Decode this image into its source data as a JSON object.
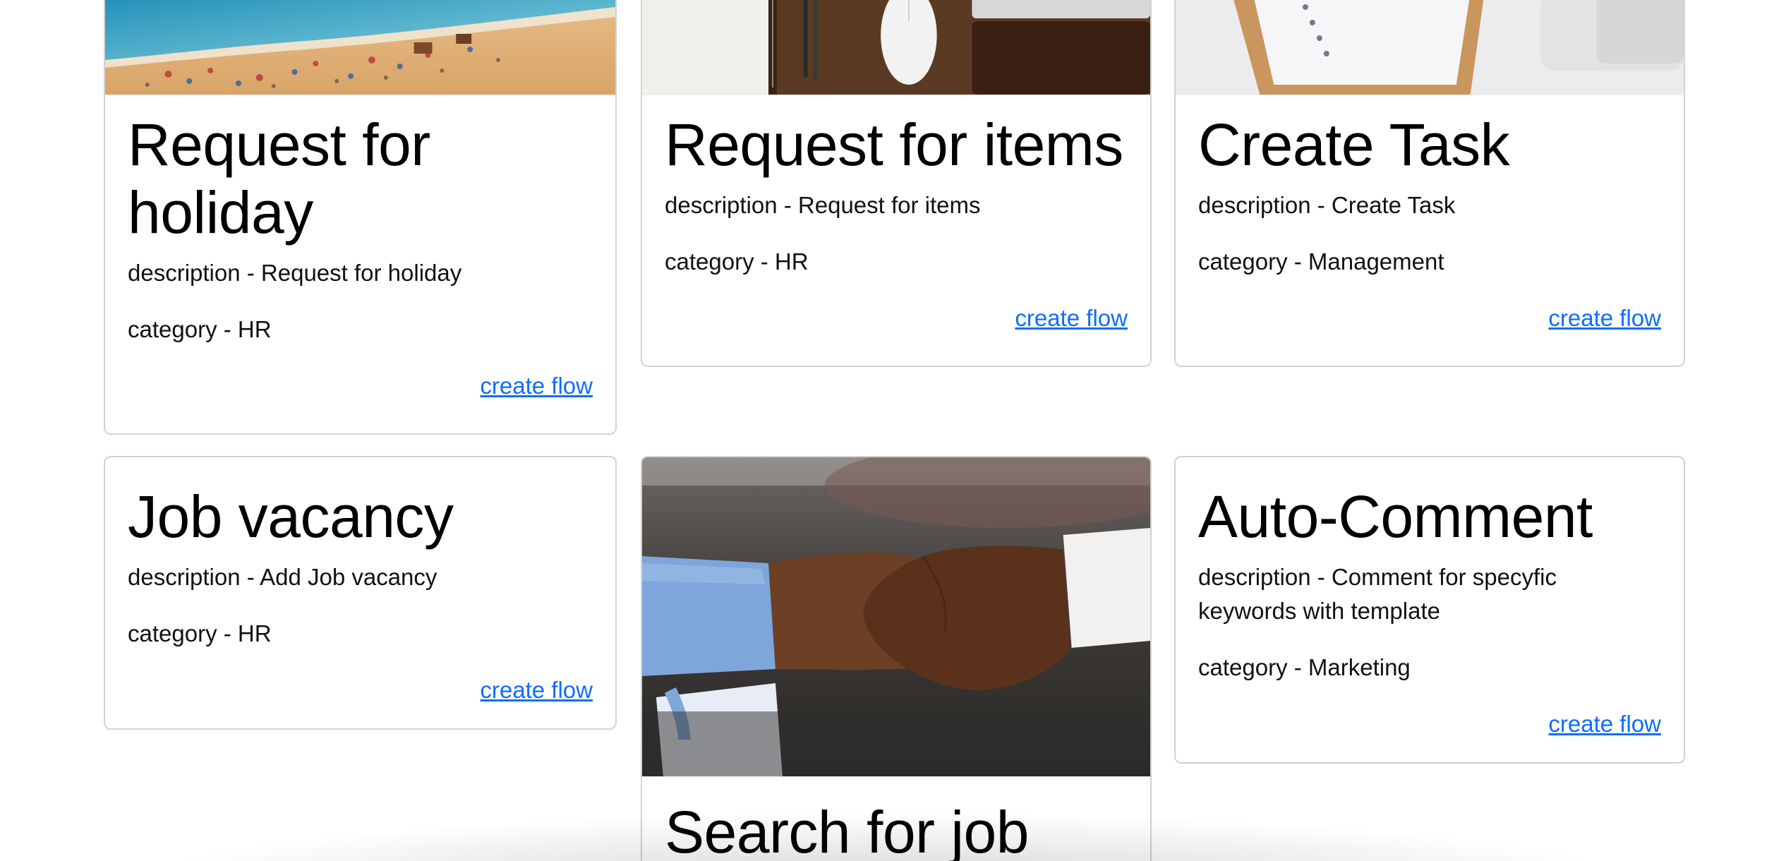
{
  "cards": [
    {
      "title": "Request for holiday",
      "description": "description - Request for holiday",
      "category": "category - HR",
      "link": "create flow",
      "image": "beach-photo"
    },
    {
      "title": "Request for items",
      "description": "description - Request for items",
      "category": "category - HR",
      "link": "create flow",
      "image": "desk-items-photo"
    },
    {
      "title": "Create Task",
      "description": "description - Create Task",
      "category": "category - Management",
      "link": "create flow",
      "image": "clipboard-laptop-photo"
    },
    {
      "title": "Job vacancy",
      "description": "description - Add Job vacancy",
      "category": "category - HR",
      "link": "create flow"
    },
    {
      "title": "Search for job",
      "image": "handshake-photo"
    },
    {
      "title": "Auto-Comment",
      "description": "description - Comment for specyfic keywords with template",
      "category": "category - Marketing",
      "link": "create flow"
    }
  ],
  "colors": {
    "link": "#0d6efd",
    "border": "#d9d9d9",
    "title": "#000000"
  }
}
